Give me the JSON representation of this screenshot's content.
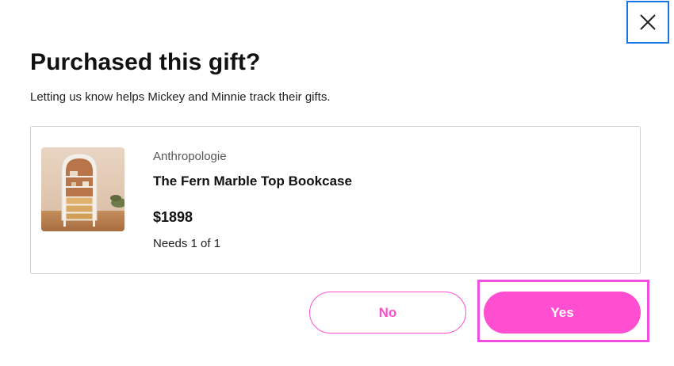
{
  "dialog": {
    "title": "Purchased this gift?",
    "subtitle": "Letting us know helps Mickey and Minnie track their gifts.",
    "close_icon": "close-icon"
  },
  "gift": {
    "store": "Anthropologie",
    "name": "The Fern Marble Top Bookcase",
    "price": "$1898",
    "needs": "Needs 1 of 1",
    "image_icon": "bookcase-image"
  },
  "actions": {
    "no_label": "No",
    "yes_label": "Yes"
  },
  "colors": {
    "accent": "#ff4fd0",
    "focus_outline": "#1a73e8",
    "card_border": "#cfcfcf"
  }
}
